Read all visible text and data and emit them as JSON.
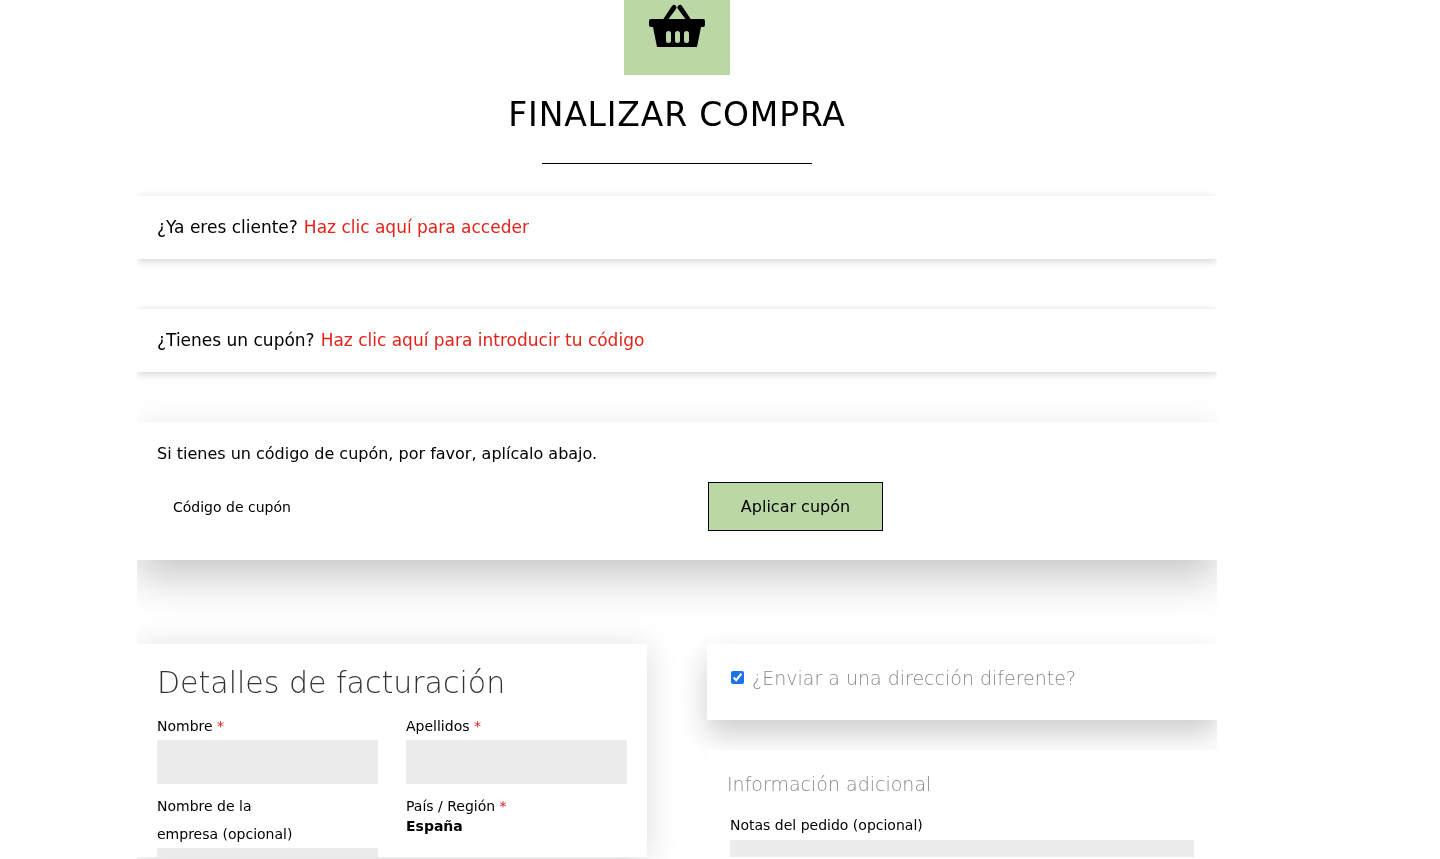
{
  "page_title": "FINALIZAR COMPRA",
  "notices": [
    {
      "text": "¿Ya eres cliente?",
      "link": "Haz clic aquí para acceder"
    },
    {
      "text": "¿Tienes un cupón?",
      "link": "Haz clic aquí para introducir tu código"
    }
  ],
  "coupon": {
    "text": "Si tienes un código de cupón, por favor, aplícalo abajo.",
    "placeholder": "Código de cupón",
    "button": "Aplicar cupón"
  },
  "billing": {
    "heading": "Detalles de facturación",
    "fields": [
      {
        "kind": "input",
        "label": "Nombre",
        "required_mark": "*"
      },
      {
        "kind": "input",
        "label": "Apellidos",
        "required_mark": "*"
      },
      {
        "kind": "input",
        "label": "Nombre de la empresa (opcional)"
      },
      {
        "kind": "static",
        "label": "País / Región",
        "required_mark": "*",
        "value": "España"
      }
    ]
  },
  "shipping": {
    "label": "¿Enviar a una dirección diferente?",
    "checked": true
  },
  "additional": {
    "heading": "Información adicional",
    "notes_label": "Notas del pedido (opcional)"
  }
}
